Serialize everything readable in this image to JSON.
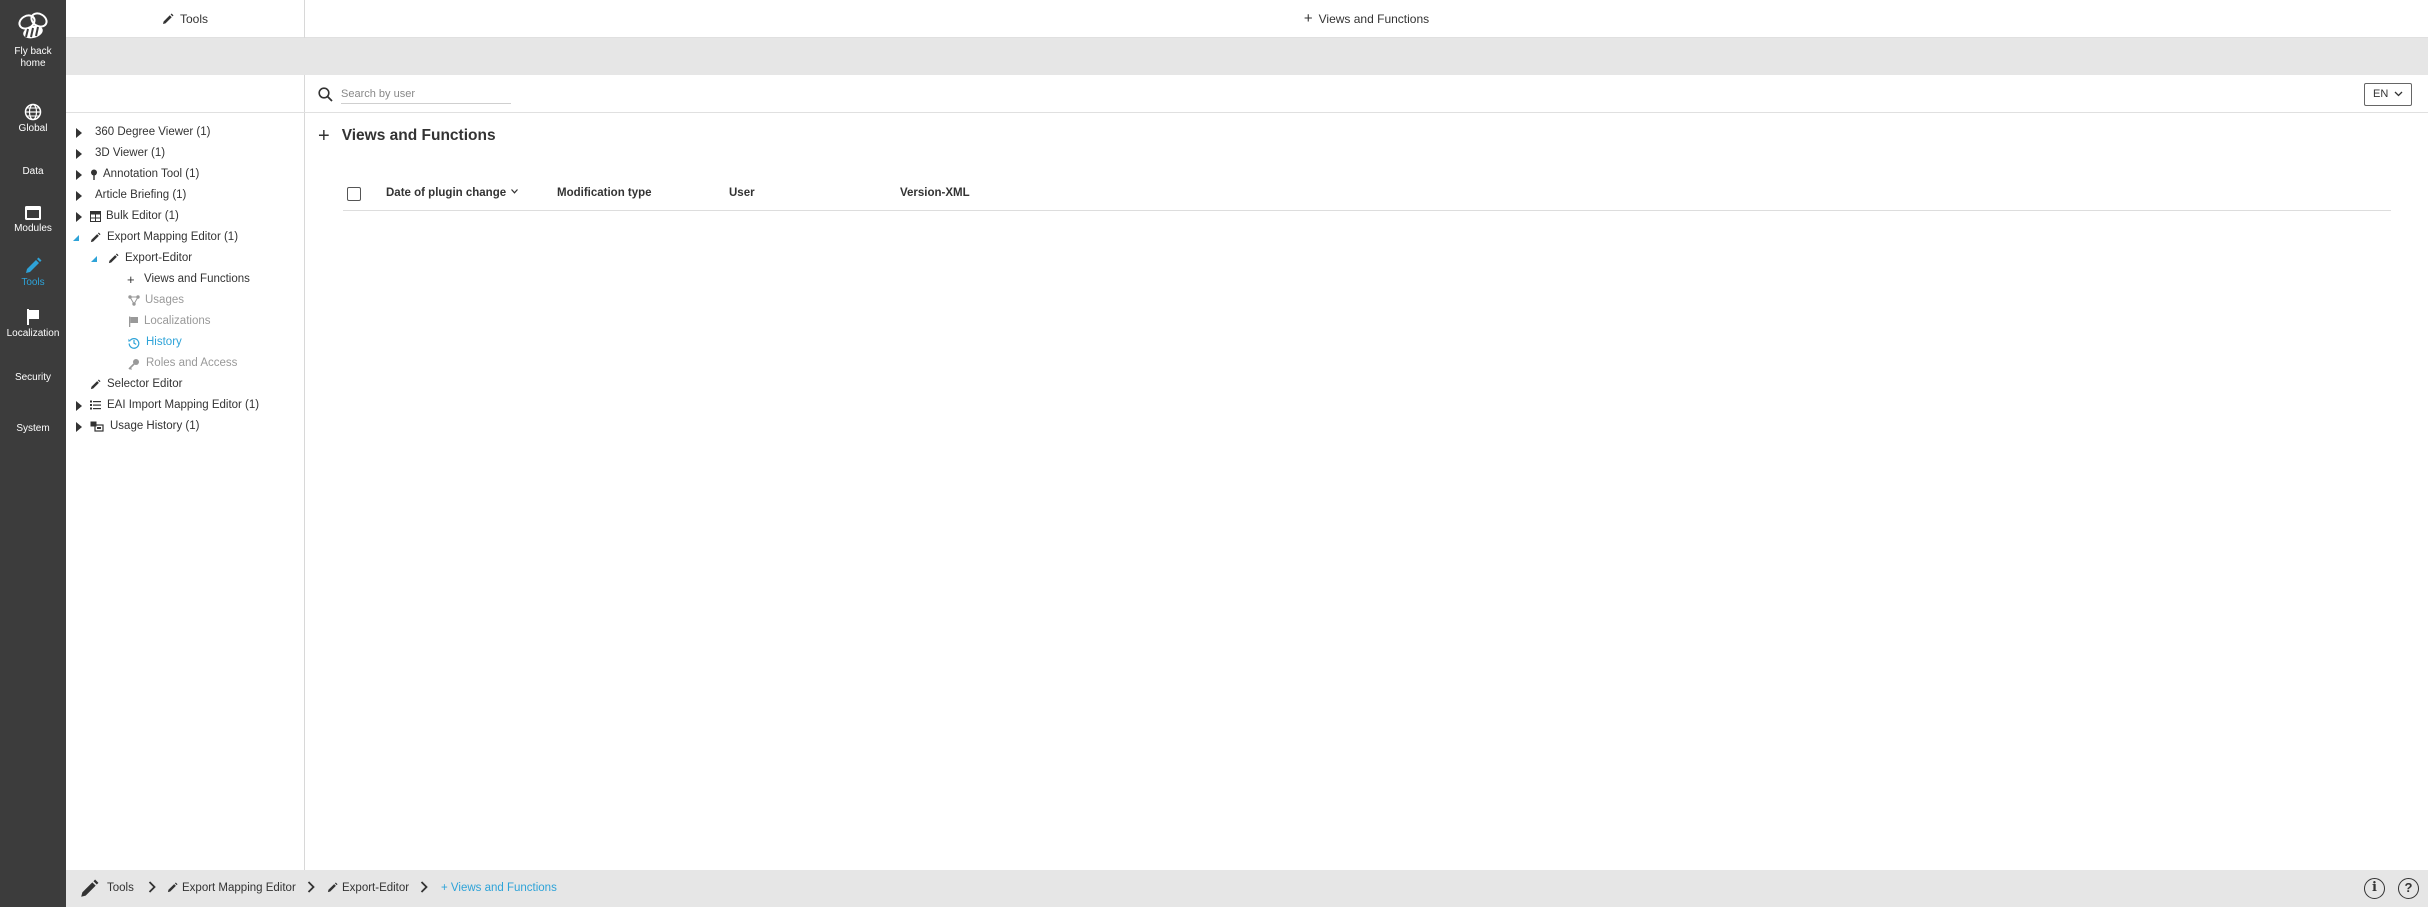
{
  "leftnav": {
    "home_label_1": "Fly back",
    "home_label_2": "home",
    "items": [
      {
        "label": "Global",
        "icon": "globe-icon"
      },
      {
        "label": "Data",
        "icon": ""
      },
      {
        "label": "Modules",
        "icon": "window-icon"
      },
      {
        "label": "Tools",
        "icon": "pencil-icon",
        "active": true
      },
      {
        "label": "Localization",
        "icon": "flag-icon"
      },
      {
        "label": "Security",
        "icon": ""
      },
      {
        "label": "System",
        "icon": ""
      }
    ]
  },
  "tree_panel": {
    "title": "Tools",
    "items": [
      {
        "label": "360 Degree Viewer (1)",
        "icon": ""
      },
      {
        "label": "3D Viewer (1)",
        "icon": ""
      },
      {
        "label": "Annotation Tool (1)",
        "icon": "pin-icon"
      },
      {
        "label": "Article Briefing (1)",
        "icon": ""
      },
      {
        "label": "Bulk Editor (1)",
        "icon": "table-icon"
      },
      {
        "label": "Export Mapping Editor (1)",
        "icon": "pencil-icon"
      },
      {
        "label": "Export-Editor",
        "icon": "pencil-icon"
      },
      {
        "label": "Views and Functions",
        "icon": "plus-icon"
      },
      {
        "label": "Usages",
        "icon": "share-icon"
      },
      {
        "label": "Localizations",
        "icon": "flag-icon"
      },
      {
        "label": "History",
        "icon": "history-icon"
      },
      {
        "label": "Roles and Access",
        "icon": "key-icon"
      },
      {
        "label": "Selector Editor",
        "icon": "pencil-icon"
      },
      {
        "label": "EAI Import Mapping Editor (1)",
        "icon": "list-icon"
      },
      {
        "label": "Usage History (1)",
        "icon": "history-icon"
      }
    ]
  },
  "topbar": {
    "title": "Views and Functions"
  },
  "search": {
    "placeholder": "Search by user",
    "value": ""
  },
  "language": {
    "selected": "EN"
  },
  "content": {
    "title": "Views and Functions",
    "columns": [
      "Date of plugin change",
      "Modification type",
      "User",
      "Version-XML"
    ],
    "rows": []
  },
  "breadcrumb": {
    "items": [
      "Tools",
      "Export Mapping Editor",
      "Export-Editor",
      "Views and Functions"
    ]
  },
  "colors": {
    "accent": "#2ea3d8",
    "nav_bg": "#3c3c3c",
    "bar_bg": "#e6e6e6"
  }
}
